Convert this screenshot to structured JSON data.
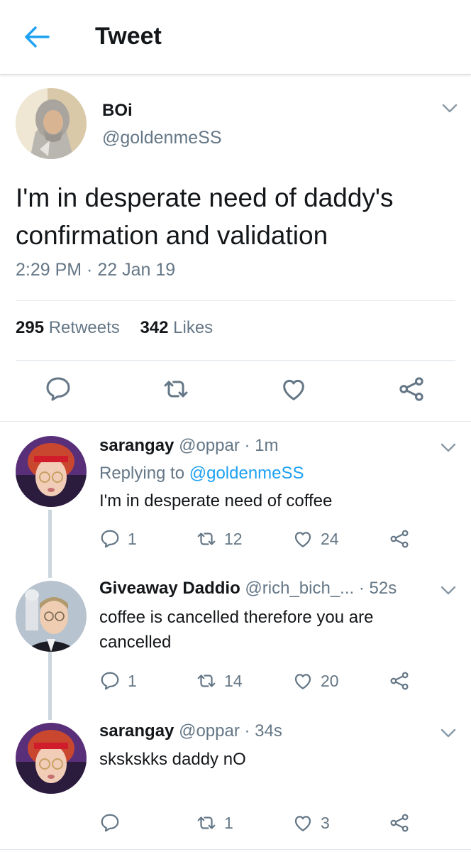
{
  "header": {
    "title": "Tweet",
    "back_icon": "arrow-left-icon",
    "accent": "#1da1f2"
  },
  "tweet": {
    "name": "BOi",
    "handle": "@goldenmeSS",
    "text": "I'm in desperate need of daddy's confirmation and validation",
    "timestamp": "2:29 PM · 22 Jan 19",
    "retweets_count": "295",
    "retweets_label": "Retweets",
    "likes_count": "342",
    "likes_label": "Likes",
    "actions": [
      "reply-icon",
      "retweet-icon",
      "like-icon",
      "share-icon"
    ]
  },
  "replies": [
    {
      "name": "sarangay",
      "handle": "@oppar",
      "time": "· 1m",
      "replying_prefix": "Replying to",
      "replying_to": "@goldenmeSS",
      "text": "I'm in desperate need of coffee",
      "replies": "1",
      "retweets": "12",
      "likes": "24"
    },
    {
      "name": "Giveaway Daddio",
      "handle": "@rich_bich_...",
      "time": "· 52s",
      "text": "coffee is cancelled therefore you are cancelled",
      "replies": "1",
      "retweets": "14",
      "likes": "20"
    },
    {
      "name": "sarangay",
      "handle": "@oppar",
      "time": "· 34s",
      "text": "skskskks daddy nO",
      "replies": "",
      "retweets": "1",
      "likes": "3"
    }
  ]
}
